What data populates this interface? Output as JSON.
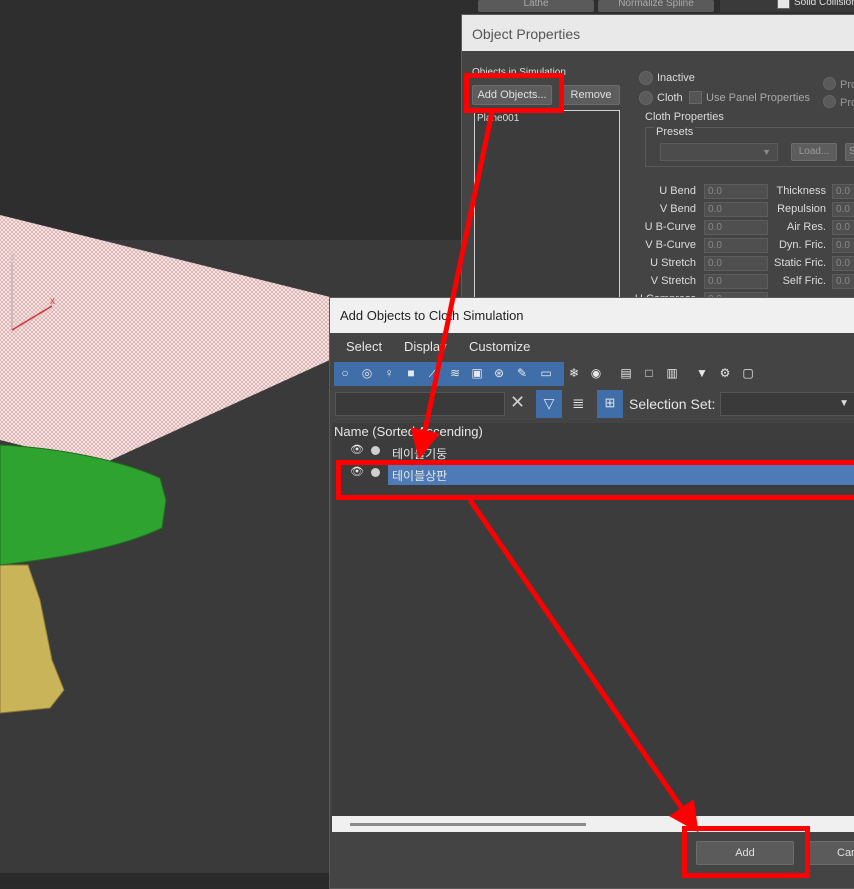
{
  "top_toolbar": {
    "lathe": "Lathe",
    "normalize_spline": "Normalize Spline",
    "solid_collision": "Solid Collision"
  },
  "object_properties": {
    "title": "Object Properties",
    "objects_in_simulation": "Objects in Simulation",
    "add_objects": "Add Objects...",
    "remove": "Remove",
    "list_item": "Plane001",
    "inactive": "Inactive",
    "cloth": "Cloth",
    "use_panel_properties": "Use Panel Properties",
    "pro1": "Pro",
    "pro2": "Pro",
    "cloth_properties": "Cloth Properties",
    "presets": "Presets",
    "load": "Load...",
    "sa": "Sa",
    "params_left": [
      {
        "label": "U Bend",
        "value": "0.0"
      },
      {
        "label": "V Bend",
        "value": "0.0"
      },
      {
        "label": "U B-Curve",
        "value": "0.0"
      },
      {
        "label": "V B-Curve",
        "value": "0.0"
      },
      {
        "label": "U Stretch",
        "value": "0.0"
      },
      {
        "label": "V Stretch",
        "value": "0.0"
      },
      {
        "label": "U Compress",
        "value": "0.0"
      }
    ],
    "params_right": [
      {
        "label": "Thickness",
        "value": "0.0"
      },
      {
        "label": "Repulsion",
        "value": "0.0"
      },
      {
        "label": "Air Res.",
        "value": "0.0"
      },
      {
        "label": "Dyn. Fric.",
        "value": "0.0"
      },
      {
        "label": "Static Fric.",
        "value": "0.0"
      },
      {
        "label": "Self Fric.",
        "value": "0.0"
      }
    ]
  },
  "add_objects_dialog": {
    "title": "Add Objects to Cloth Simulation",
    "menu": [
      "Select",
      "Display",
      "Customize"
    ],
    "selection_set_label": "Selection Set:",
    "column_header": "Name (Sorted Ascending)",
    "rows": [
      "테이블기둥",
      "테이블상판"
    ],
    "add_button": "Add",
    "cancel_button": "Cancel"
  },
  "viewport": {
    "axis_z": "z",
    "axis_x": "x"
  },
  "colors": {
    "highlight": "#ff0000",
    "selected_row": "#4f7ab8",
    "table_top": "#2fa32f",
    "table_leg": "#c9b45a"
  }
}
